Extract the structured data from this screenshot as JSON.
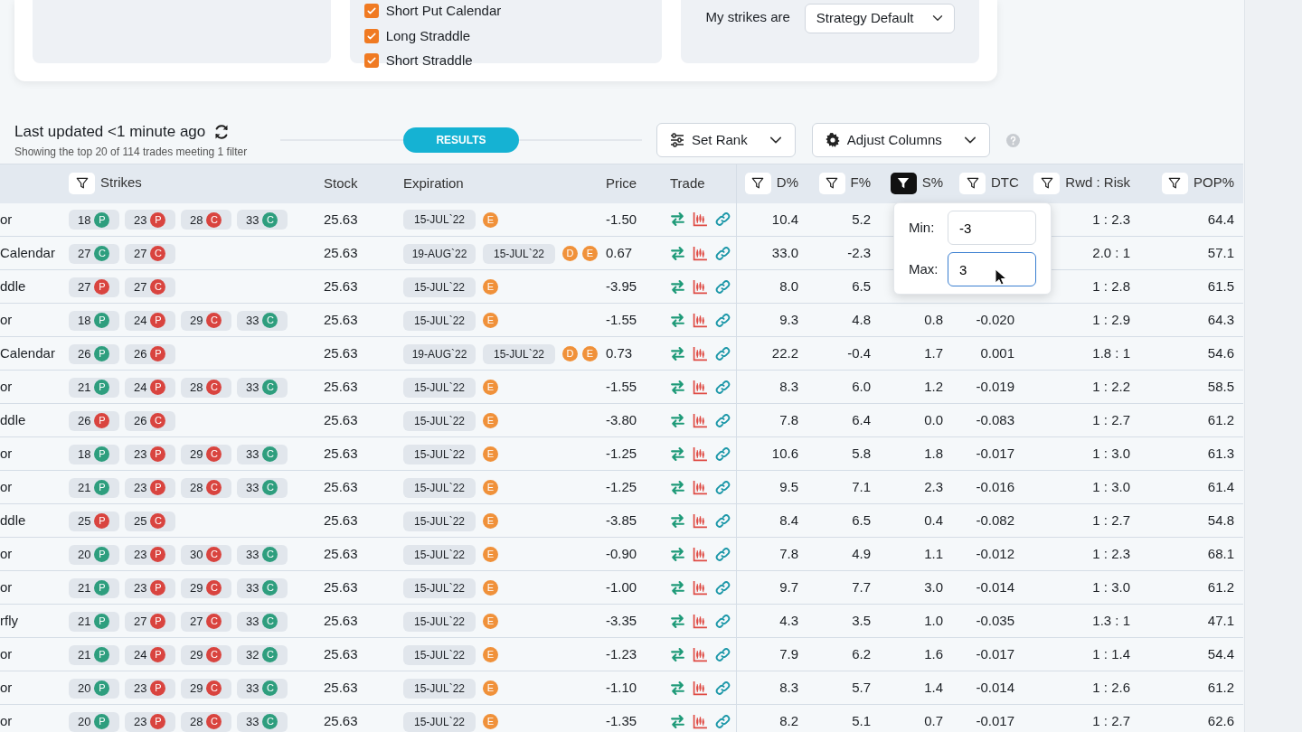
{
  "filter_panels": {
    "strategies": [
      {
        "label": "Short Put Calendar",
        "checked": true
      },
      {
        "label": "Long Straddle",
        "checked": true
      },
      {
        "label": "Short Straddle",
        "checked": true
      }
    ],
    "strikes_label": "My strikes are",
    "strikes_select": "Strategy Default"
  },
  "results_header": {
    "title": "Last updated <1 minute ago",
    "subtitle": "Showing the top 20 of 114 trades meeting 1 filter",
    "divider_label": "RESULTS",
    "buttons": [
      {
        "label": "Set Rank",
        "kind": "sliders"
      },
      {
        "label": "Adjust Columns",
        "kind": "gear"
      }
    ]
  },
  "table": {
    "columns": [
      {
        "label": "Strikes",
        "filter": true,
        "filter_active": false
      },
      {
        "label": "Stock",
        "filter": false
      },
      {
        "label": "Expiration",
        "filter": false
      },
      {
        "label": "Price",
        "filter": false
      },
      {
        "label": "Trade",
        "filter": false
      },
      {
        "label": "D%",
        "filter": true,
        "filter_active": false
      },
      {
        "label": "F%",
        "filter": true,
        "filter_active": false
      },
      {
        "label": "S%",
        "filter": true,
        "filter_active": true
      },
      {
        "label": "DTC",
        "filter": true,
        "filter_active": false
      },
      {
        "label": "Rwd : Risk",
        "filter": true,
        "filter_active": false
      },
      {
        "label": "POP%",
        "filter": true,
        "filter_active": false
      }
    ],
    "rows": [
      {
        "strategy": "or",
        "strikes": [
          {
            "strike": "18",
            "type": "P",
            "color": "#2e9e7e"
          },
          {
            "strike": "23",
            "type": "P",
            "color": "#d9443f"
          },
          {
            "strike": "28",
            "type": "C",
            "color": "#d9443f"
          },
          {
            "strike": "33",
            "type": "C",
            "color": "#2e9e7e"
          }
        ],
        "stock": "25.63",
        "expirations": [
          "15-JUL`22"
        ],
        "markers": [
          "E"
        ],
        "price": "-1.50",
        "d_pct": "10.4",
        "f_pct": "5.2",
        "rwd_risk": "1 : 2.3",
        "pop_pct": "64.4"
      },
      {
        "strategy": "Calendar",
        "strikes": [
          {
            "strike": "27",
            "type": "C",
            "color": "#2e9e7e"
          },
          {
            "strike": "27",
            "type": "C",
            "color": "#d9443f"
          }
        ],
        "stock": "25.63",
        "expirations": [
          "19-AUG`22",
          "15-JUL`22"
        ],
        "markers": [
          "D",
          "E"
        ],
        "price": "0.67",
        "d_pct": "33.0",
        "f_pct": "-2.3",
        "rwd_risk": "2.0 : 1",
        "pop_pct": "57.1"
      },
      {
        "strategy": "ddle",
        "strikes": [
          {
            "strike": "27",
            "type": "P",
            "color": "#d9443f"
          },
          {
            "strike": "27",
            "type": "C",
            "color": "#d9443f"
          }
        ],
        "stock": "25.63",
        "expirations": [
          "15-JUL`22"
        ],
        "markers": [
          "E"
        ],
        "price": "-3.95",
        "d_pct": "8.0",
        "f_pct": "6.5",
        "rwd_risk": "1 : 2.8",
        "pop_pct": "61.5"
      },
      {
        "strategy": "or",
        "strikes": [
          {
            "strike": "18",
            "type": "P",
            "color": "#2e9e7e"
          },
          {
            "strike": "24",
            "type": "P",
            "color": "#d9443f"
          },
          {
            "strike": "29",
            "type": "C",
            "color": "#d9443f"
          },
          {
            "strike": "33",
            "type": "C",
            "color": "#2e9e7e"
          }
        ],
        "stock": "25.63",
        "expirations": [
          "15-JUL`22"
        ],
        "markers": [
          "E"
        ],
        "price": "-1.55",
        "d_pct": "9.3",
        "f_pct": "4.8",
        "s_pct": "0.8",
        "dtc": "-0.020",
        "rwd_risk": "1 : 2.9",
        "pop_pct": "64.3"
      },
      {
        "strategy": "Calendar",
        "strikes": [
          {
            "strike": "26",
            "type": "P",
            "color": "#2e9e7e"
          },
          {
            "strike": "26",
            "type": "P",
            "color": "#d9443f"
          }
        ],
        "stock": "25.63",
        "expirations": [
          "19-AUG`22",
          "15-JUL`22"
        ],
        "markers": [
          "D",
          "E"
        ],
        "price": "0.73",
        "d_pct": "22.2",
        "f_pct": "-0.4",
        "s_pct": "1.7",
        "dtc": "0.001",
        "rwd_risk": "1.8 : 1",
        "pop_pct": "54.6"
      },
      {
        "strategy": "or",
        "strikes": [
          {
            "strike": "21",
            "type": "P",
            "color": "#2e9e7e"
          },
          {
            "strike": "24",
            "type": "P",
            "color": "#d9443f"
          },
          {
            "strike": "28",
            "type": "C",
            "color": "#d9443f"
          },
          {
            "strike": "33",
            "type": "C",
            "color": "#2e9e7e"
          }
        ],
        "stock": "25.63",
        "expirations": [
          "15-JUL`22"
        ],
        "markers": [
          "E"
        ],
        "price": "-1.55",
        "d_pct": "8.3",
        "f_pct": "6.0",
        "s_pct": "1.2",
        "dtc": "-0.019",
        "rwd_risk": "1 : 2.2",
        "pop_pct": "58.5"
      },
      {
        "strategy": "ddle",
        "strikes": [
          {
            "strike": "26",
            "type": "P",
            "color": "#d9443f"
          },
          {
            "strike": "26",
            "type": "C",
            "color": "#d9443f"
          }
        ],
        "stock": "25.63",
        "expirations": [
          "15-JUL`22"
        ],
        "markers": [
          "E"
        ],
        "price": "-3.80",
        "d_pct": "7.8",
        "f_pct": "6.4",
        "s_pct": "0.0",
        "dtc": "-0.083",
        "rwd_risk": "1 : 2.7",
        "pop_pct": "61.2"
      },
      {
        "strategy": "or",
        "strikes": [
          {
            "strike": "18",
            "type": "P",
            "color": "#2e9e7e"
          },
          {
            "strike": "23",
            "type": "P",
            "color": "#d9443f"
          },
          {
            "strike": "29",
            "type": "C",
            "color": "#d9443f"
          },
          {
            "strike": "33",
            "type": "C",
            "color": "#2e9e7e"
          }
        ],
        "stock": "25.63",
        "expirations": [
          "15-JUL`22"
        ],
        "markers": [
          "E"
        ],
        "price": "-1.25",
        "d_pct": "10.6",
        "f_pct": "5.8",
        "s_pct": "1.8",
        "dtc": "-0.017",
        "rwd_risk": "1 : 3.0",
        "pop_pct": "61.3"
      },
      {
        "strategy": "or",
        "strikes": [
          {
            "strike": "21",
            "type": "P",
            "color": "#2e9e7e"
          },
          {
            "strike": "23",
            "type": "P",
            "color": "#d9443f"
          },
          {
            "strike": "28",
            "type": "C",
            "color": "#d9443f"
          },
          {
            "strike": "33",
            "type": "C",
            "color": "#2e9e7e"
          }
        ],
        "stock": "25.63",
        "expirations": [
          "15-JUL`22"
        ],
        "markers": [
          "E"
        ],
        "price": "-1.25",
        "d_pct": "9.5",
        "f_pct": "7.1",
        "s_pct": "2.3",
        "dtc": "-0.016",
        "rwd_risk": "1 : 3.0",
        "pop_pct": "61.4"
      },
      {
        "strategy": "ddle",
        "strikes": [
          {
            "strike": "25",
            "type": "P",
            "color": "#d9443f"
          },
          {
            "strike": "25",
            "type": "C",
            "color": "#d9443f"
          }
        ],
        "stock": "25.63",
        "expirations": [
          "15-JUL`22"
        ],
        "markers": [
          "E"
        ],
        "price": "-3.85",
        "d_pct": "8.4",
        "f_pct": "6.5",
        "s_pct": "0.4",
        "dtc": "-0.082",
        "rwd_risk": "1 : 2.7",
        "pop_pct": "54.8"
      },
      {
        "strategy": "or",
        "strikes": [
          {
            "strike": "20",
            "type": "P",
            "color": "#2e9e7e"
          },
          {
            "strike": "23",
            "type": "P",
            "color": "#d9443f"
          },
          {
            "strike": "30",
            "type": "C",
            "color": "#d9443f"
          },
          {
            "strike": "33",
            "type": "C",
            "color": "#2e9e7e"
          }
        ],
        "stock": "25.63",
        "expirations": [
          "15-JUL`22"
        ],
        "markers": [
          "E"
        ],
        "price": "-0.90",
        "d_pct": "7.8",
        "f_pct": "4.9",
        "s_pct": "1.1",
        "dtc": "-0.012",
        "rwd_risk": "1 : 2.3",
        "pop_pct": "68.1"
      },
      {
        "strategy": "or",
        "strikes": [
          {
            "strike": "21",
            "type": "P",
            "color": "#2e9e7e"
          },
          {
            "strike": "23",
            "type": "P",
            "color": "#d9443f"
          },
          {
            "strike": "29",
            "type": "C",
            "color": "#d9443f"
          },
          {
            "strike": "33",
            "type": "C",
            "color": "#2e9e7e"
          }
        ],
        "stock": "25.63",
        "expirations": [
          "15-JUL`22"
        ],
        "markers": [
          "E"
        ],
        "price": "-1.00",
        "d_pct": "9.7",
        "f_pct": "7.7",
        "s_pct": "3.0",
        "dtc": "-0.014",
        "rwd_risk": "1 : 3.0",
        "pop_pct": "61.2"
      },
      {
        "strategy": "rfly",
        "strikes": [
          {
            "strike": "21",
            "type": "P",
            "color": "#2e9e7e"
          },
          {
            "strike": "27",
            "type": "P",
            "color": "#d9443f"
          },
          {
            "strike": "27",
            "type": "C",
            "color": "#d9443f"
          },
          {
            "strike": "33",
            "type": "C",
            "color": "#2e9e7e"
          }
        ],
        "stock": "25.63",
        "expirations": [
          "15-JUL`22"
        ],
        "markers": [
          "E"
        ],
        "price": "-3.35",
        "d_pct": "4.3",
        "f_pct": "3.5",
        "s_pct": "1.0",
        "dtc": "-0.035",
        "rwd_risk": "1.3 : 1",
        "pop_pct": "47.1"
      },
      {
        "strategy": "or",
        "strikes": [
          {
            "strike": "21",
            "type": "P",
            "color": "#2e9e7e"
          },
          {
            "strike": "24",
            "type": "P",
            "color": "#d9443f"
          },
          {
            "strike": "29",
            "type": "C",
            "color": "#d9443f"
          },
          {
            "strike": "32",
            "type": "C",
            "color": "#2e9e7e"
          }
        ],
        "stock": "25.63",
        "expirations": [
          "15-JUL`22"
        ],
        "markers": [
          "E"
        ],
        "price": "-1.23",
        "d_pct": "7.9",
        "f_pct": "6.2",
        "s_pct": "1.6",
        "dtc": "-0.017",
        "rwd_risk": "1 : 1.4",
        "pop_pct": "54.4"
      },
      {
        "strategy": "or",
        "strikes": [
          {
            "strike": "20",
            "type": "P",
            "color": "#2e9e7e"
          },
          {
            "strike": "23",
            "type": "P",
            "color": "#d9443f"
          },
          {
            "strike": "29",
            "type": "C",
            "color": "#d9443f"
          },
          {
            "strike": "33",
            "type": "C",
            "color": "#2e9e7e"
          }
        ],
        "stock": "25.63",
        "expirations": [
          "15-JUL`22"
        ],
        "markers": [
          "E"
        ],
        "price": "-1.10",
        "d_pct": "8.3",
        "f_pct": "5.7",
        "s_pct": "1.4",
        "dtc": "-0.014",
        "rwd_risk": "1 : 2.6",
        "pop_pct": "61.2"
      },
      {
        "strategy": "or",
        "strikes": [
          {
            "strike": "20",
            "type": "P",
            "color": "#2e9e7e"
          },
          {
            "strike": "23",
            "type": "P",
            "color": "#d9443f"
          },
          {
            "strike": "28",
            "type": "C",
            "color": "#d9443f"
          },
          {
            "strike": "33",
            "type": "C",
            "color": "#2e9e7e"
          }
        ],
        "stock": "25.63",
        "expirations": [
          "15-JUL`22"
        ],
        "markers": [
          "E"
        ],
        "price": "-1.35",
        "d_pct": "8.2",
        "f_pct": "5.1",
        "s_pct": "0.7",
        "dtc": "-0.017",
        "rwd_risk": "1 : 2.7",
        "pop_pct": "62.6"
      }
    ]
  },
  "filter_popup": {
    "fields": [
      {
        "label": "Min:",
        "value": "-3",
        "focused": false
      },
      {
        "label": "Max:",
        "value": "3",
        "focused": true
      }
    ]
  }
}
